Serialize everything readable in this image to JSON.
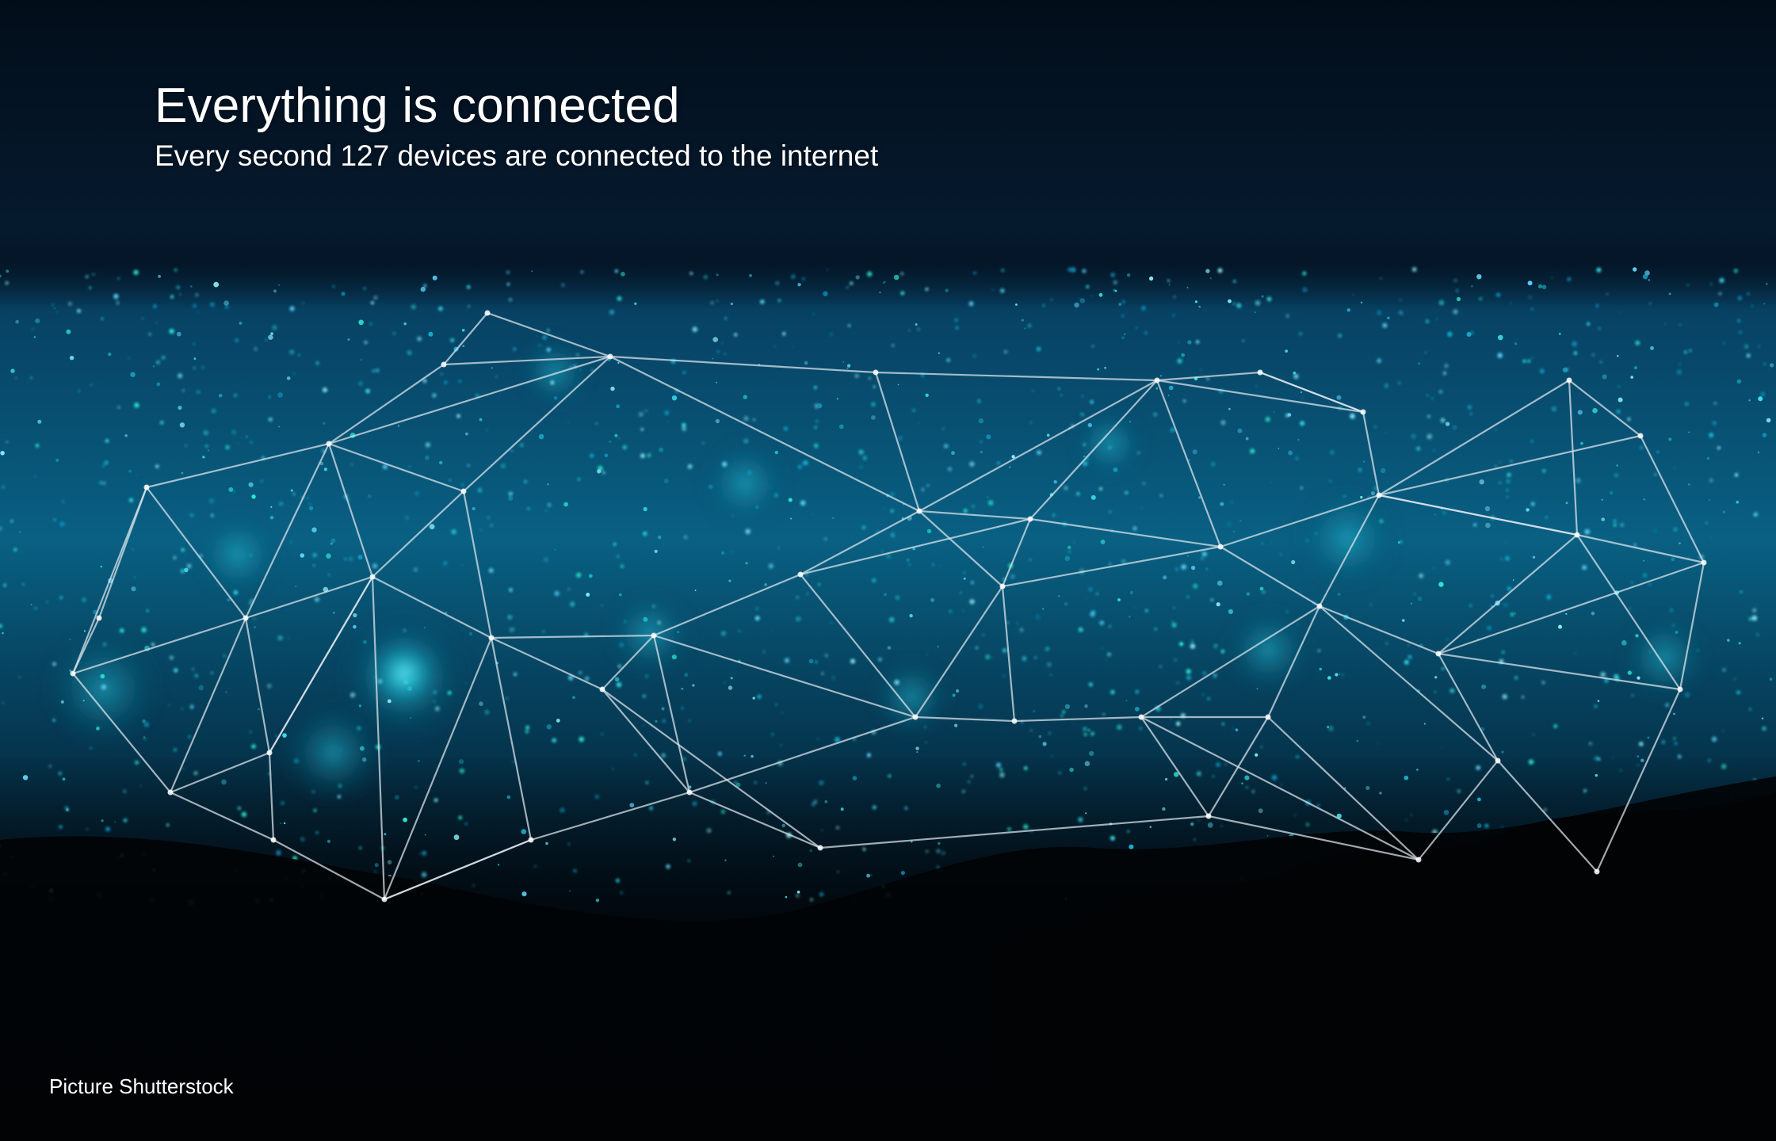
{
  "slide": {
    "title": "Everything is connected",
    "subtitle": "Every second 127 devices are connected to the internet",
    "credit": "Picture Shutterstock"
  },
  "image": {
    "description_icon": "night-city-network-photo",
    "colors": {
      "sky": "#041526",
      "city_glow": "#19d6e8",
      "network_lines": "#dfe7ee",
      "foreground": "#010305"
    }
  }
}
